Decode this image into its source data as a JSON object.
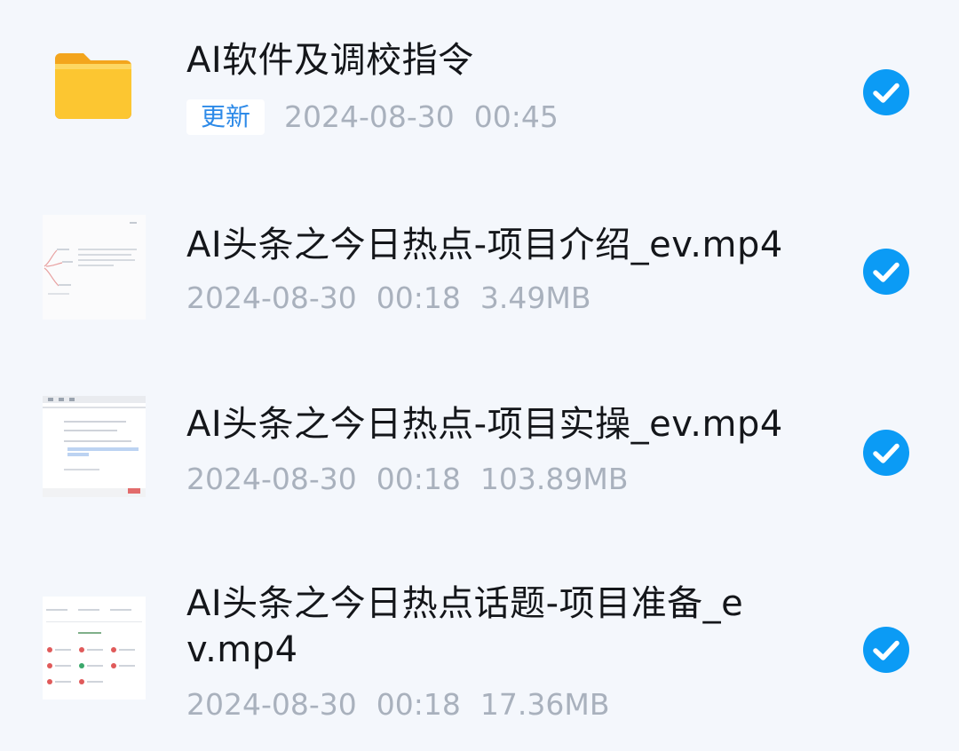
{
  "files": [
    {
      "title": "AI软件及调校指令",
      "badge": "更新",
      "date": "2024-08-30",
      "time": "00:45",
      "size": "",
      "thumbnail": "folder-icon"
    },
    {
      "title": "AI头条之今日热点-项目介绍_ev.mp4",
      "date": "2024-08-30",
      "time": "00:18",
      "size": "3.49MB",
      "thumbnail": "mindmap-video-thumbnail"
    },
    {
      "title": "AI头条之今日热点-项目实操_ev.mp4",
      "date": "2024-08-30",
      "time": "00:18",
      "size": "103.89MB",
      "thumbnail": "document-video-thumbnail"
    },
    {
      "title": "AI头条之今日热点话题-项目准备_ev.mp4",
      "date": "2024-08-30",
      "time": "00:18",
      "size": "17.36MB",
      "thumbnail": "grid-video-thumbnail"
    }
  ],
  "colors": {
    "background": "#f4f7fc",
    "check": "#0b9bf5",
    "badge_text": "#2d8ae8",
    "meta_text": "#a9b1bd",
    "title_text": "#14161a",
    "folder": "#fbc12f"
  }
}
